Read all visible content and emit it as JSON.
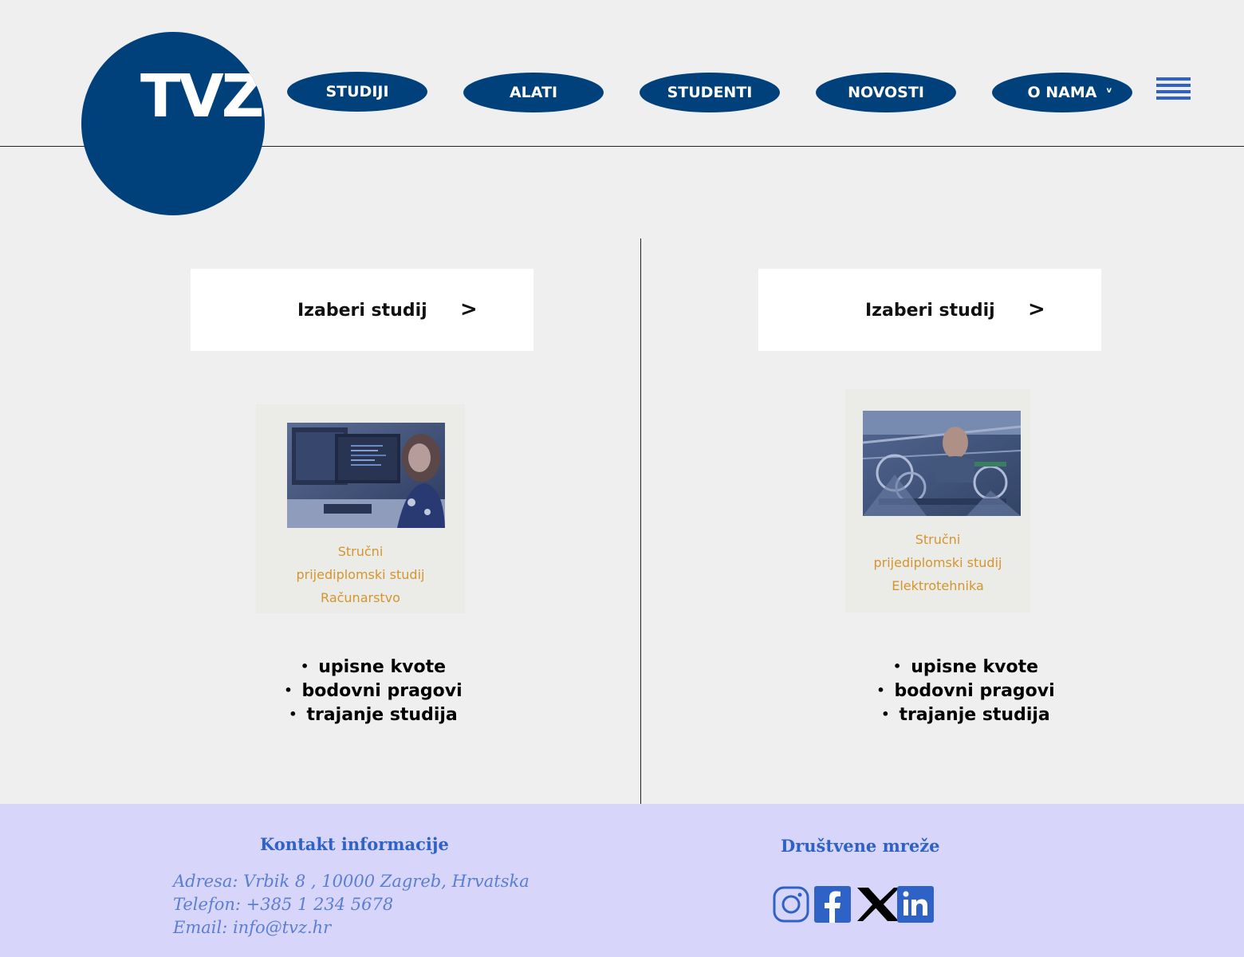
{
  "logo": {
    "text": "TVZ"
  },
  "nav": {
    "items": [
      {
        "label": "STUDIJI"
      },
      {
        "label": "ALATI"
      },
      {
        "label": "STUDENTI"
      },
      {
        "label": "NOVOSTI"
      },
      {
        "label": "O NAMA",
        "chevron": "v"
      }
    ],
    "menu_icon": "hamburger-icon"
  },
  "columns": [
    {
      "select_label": "Izaberi studij",
      "select_arrow": ">",
      "card": {
        "caption_lines": [
          "Stručni",
          "prijediplomski studij",
          "Računarstvo"
        ]
      },
      "list": [
        "upisne kvote",
        "bodovni pragovi",
        "trajanje studija"
      ]
    },
    {
      "select_label": "Izaberi studij",
      "select_arrow": ">",
      "card": {
        "caption_lines": [
          "Stručni",
          "prijediplomski studij",
          "Elektrotehnika"
        ]
      },
      "list": [
        "upisne kvote",
        "bodovni pragovi",
        "trajanje studija"
      ]
    }
  ],
  "footer": {
    "contact_title": "Kontakt informacije",
    "address": "Adresa: Vrbik 8 , 10000 Zagreb, Hrvatska",
    "phone": "Telefon: +385 1 234 5678",
    "email": "Email: info@tvz.hr",
    "social_title": "Društvene mreže",
    "social_icons": [
      "instagram-icon",
      "facebook-icon",
      "x-icon",
      "linkedin-icon"
    ]
  },
  "colors": {
    "brand_blue": "#00417b",
    "accent_blue": "#2f62c7",
    "caption_orange": "#d4952e",
    "footer_bg": "#d8d5fb"
  }
}
